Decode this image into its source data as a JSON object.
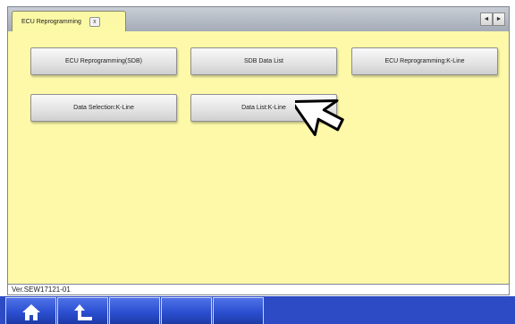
{
  "tab": {
    "label": "ECU Reprogramming",
    "close_glyph": "x"
  },
  "scroll": {
    "left": "◄",
    "right": "►"
  },
  "buttons": [
    {
      "label": "ECU Reprogramming(SDB)"
    },
    {
      "label": "SDB Data List"
    },
    {
      "label": "ECU Reprogramming:K-Line"
    },
    {
      "label": "Data Selection:K-Line"
    },
    {
      "label": "Data List:K-Line"
    }
  ],
  "status": {
    "version": "Ver.SEW17121-01"
  },
  "toolbar": {
    "icons": [
      "home-icon",
      "back-icon"
    ]
  },
  "colors": {
    "content_bg": "#fdf9a9",
    "bottom_bar": "#2d4bc4"
  }
}
